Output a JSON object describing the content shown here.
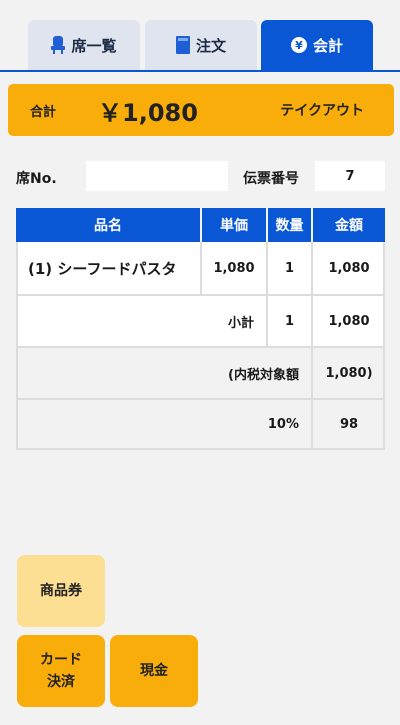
{
  "tabs": [
    {
      "label": "席一覧",
      "icon": "seat-icon",
      "active": false
    },
    {
      "label": "注文",
      "icon": "book-icon",
      "active": false
    },
    {
      "label": "会計",
      "icon": "yen-coin-icon",
      "active": true
    }
  ],
  "total_bar": {
    "label": "合計",
    "amount": "￥1,080",
    "mode": "テイクアウト"
  },
  "seat": {
    "label": "席No.",
    "value": ""
  },
  "slip": {
    "label": "伝票番号",
    "value": "7"
  },
  "table": {
    "headers": {
      "name": "品名",
      "unit_price": "単価",
      "qty": "数量",
      "amount": "金額"
    },
    "items": [
      {
        "name": "(1) シーフードパスタ",
        "unit_price": "1,080",
        "qty": "1",
        "amount": "1,080"
      }
    ],
    "subtotal": {
      "label": "小計",
      "qty": "1",
      "amount": "1,080"
    },
    "tax_included": {
      "label": "(内税対象額",
      "amount": "1,080)"
    },
    "tax": {
      "rate": "10%",
      "amount": "98"
    }
  },
  "buttons": {
    "voucher": "商品券",
    "card_line1": "カード",
    "card_line2": "決済",
    "cash": "現金"
  },
  "colors": {
    "accent_blue": "#0a57d6",
    "accent_orange": "#f9ad0b",
    "voucher_light": "#fddf94"
  }
}
